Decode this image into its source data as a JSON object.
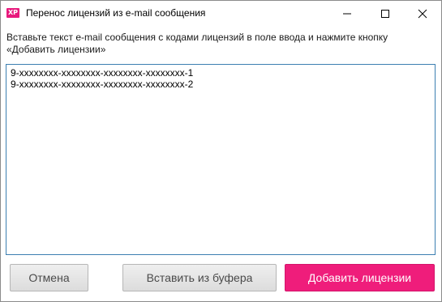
{
  "window": {
    "title": "Перенос лицензий из e-mail сообщения",
    "app_icon_text": "XP",
    "accent_color": "#ef1d7b"
  },
  "titlebar_buttons": {
    "minimize_icon": "minimize-icon",
    "maximize_icon": "maximize-icon",
    "close_icon": "close-icon"
  },
  "instructions": {
    "text": "Вставьте текст e-mail сообщения с кодами лицензий в поле ввода и нажмите кнопку «Добавить лицензии»"
  },
  "license_input": {
    "lines": [
      "9-xxxxxxxx-xxxxxxxx-xxxxxxxx-xxxxxxxx-1",
      "9-xxxxxxxx-xxxxxxxx-xxxxxxxx-xxxxxxxx-2"
    ]
  },
  "buttons": {
    "cancel_label": "Отмена",
    "paste_label": "Вставить из буфера",
    "add_label": "Добавить лицензии"
  }
}
